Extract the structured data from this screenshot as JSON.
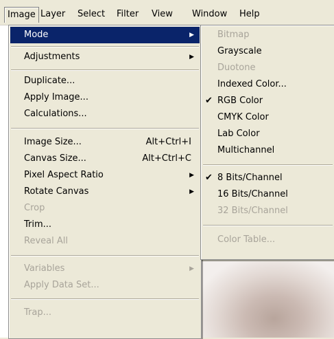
{
  "menubar": {
    "items": [
      "Image",
      "Layer",
      "Select",
      "Filter",
      "View",
      "Window",
      "Help"
    ]
  },
  "image_menu": {
    "items": [
      {
        "label": "Mode",
        "shortcut": "",
        "submenu": true,
        "enabled": true,
        "highlighted": true
      },
      {
        "label": "Adjustments",
        "shortcut": "",
        "submenu": true,
        "enabled": true
      },
      {
        "label": "Duplicate...",
        "shortcut": "",
        "enabled": true
      },
      {
        "label": "Apply Image...",
        "shortcut": "",
        "enabled": true
      },
      {
        "label": "Calculations...",
        "shortcut": "",
        "enabled": true
      },
      {
        "label": "Image Size...",
        "shortcut": "Alt+Ctrl+I",
        "enabled": true
      },
      {
        "label": "Canvas Size...",
        "shortcut": "Alt+Ctrl+C",
        "enabled": true
      },
      {
        "label": "Pixel Aspect Ratio",
        "shortcut": "",
        "submenu": true,
        "enabled": true
      },
      {
        "label": "Rotate Canvas",
        "shortcut": "",
        "submenu": true,
        "enabled": true
      },
      {
        "label": "Crop",
        "shortcut": "",
        "enabled": false
      },
      {
        "label": "Trim...",
        "shortcut": "",
        "enabled": true
      },
      {
        "label": "Reveal All",
        "shortcut": "",
        "enabled": false
      },
      {
        "label": "Variables",
        "shortcut": "",
        "submenu": true,
        "enabled": false
      },
      {
        "label": "Apply Data Set...",
        "shortcut": "",
        "enabled": false
      },
      {
        "label": "Trap...",
        "shortcut": "",
        "enabled": false
      }
    ]
  },
  "mode_submenu": {
    "items": [
      {
        "label": "Bitmap",
        "enabled": false,
        "checked": false
      },
      {
        "label": "Grayscale",
        "enabled": true,
        "checked": false
      },
      {
        "label": "Duotone",
        "enabled": false,
        "checked": false
      },
      {
        "label": "Indexed Color...",
        "enabled": true,
        "checked": false
      },
      {
        "label": "RGB Color",
        "enabled": true,
        "checked": true
      },
      {
        "label": "CMYK Color",
        "enabled": true,
        "checked": false
      },
      {
        "label": "Lab Color",
        "enabled": true,
        "checked": false
      },
      {
        "label": "Multichannel",
        "enabled": true,
        "checked": false
      },
      {
        "label": "8 Bits/Channel",
        "enabled": true,
        "checked": true
      },
      {
        "label": "16 Bits/Channel",
        "enabled": true,
        "checked": false
      },
      {
        "label": "32 Bits/Channel",
        "enabled": false,
        "checked": false
      },
      {
        "label": "Color Table...",
        "enabled": false,
        "checked": false
      }
    ],
    "check_glyph": "✔"
  },
  "colors": {
    "highlight": "#0a246a",
    "disabled_text": "#a8a49a",
    "menu_bg": "#ece9d8"
  }
}
